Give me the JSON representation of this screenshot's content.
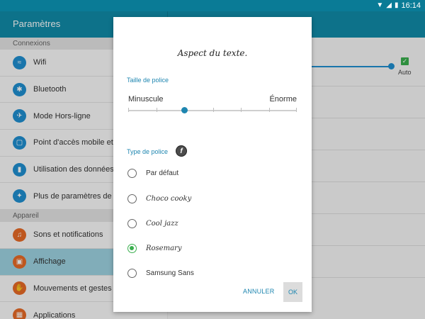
{
  "status_bar": {
    "time": "16:14"
  },
  "app_bar": {
    "title": "Paramètres"
  },
  "sidebar": {
    "sections": [
      {
        "header": "Connexions",
        "items": [
          {
            "label": "Wifi",
            "icon": "wifi-icon"
          },
          {
            "label": "Bluetooth",
            "icon": "bluetooth-icon"
          },
          {
            "label": "Mode Hors-ligne",
            "icon": "airplane-icon"
          },
          {
            "label": "Point d'accès mobile et",
            "icon": "hotspot-icon"
          },
          {
            "label": "Utilisation des données",
            "icon": "data-usage-icon"
          },
          {
            "label": "Plus de paramètres de c",
            "icon": "more-networks-icon"
          }
        ]
      },
      {
        "header": "Appareil",
        "items": [
          {
            "label": "Sons et notifications",
            "icon": "sound-icon"
          },
          {
            "label": "Affichage",
            "icon": "display-icon",
            "active": true
          },
          {
            "label": "Mouvements et gestes",
            "icon": "motion-icon"
          },
          {
            "label": "Applications",
            "icon": "apps-icon"
          }
        ]
      }
    ]
  },
  "right_pane": {
    "auto_label": "Auto"
  },
  "dialog": {
    "title": "Aspect du texte.",
    "font_size_label": "Taille de police",
    "size_min": "Minuscule",
    "size_max": "Énorme",
    "font_type_label": "Type de police",
    "font_badge": "f",
    "options": [
      {
        "label": "Par défaut",
        "checked": false
      },
      {
        "label": "Choco cooky",
        "checked": false
      },
      {
        "label": "Cool jazz",
        "checked": false
      },
      {
        "label": "Rosemary",
        "checked": true
      },
      {
        "label": "Samsung Sans",
        "checked": false
      }
    ],
    "cancel": "ANNULER",
    "ok": "OK"
  },
  "colors": {
    "accent": "#1e86b0",
    "appbar": "#108ca9",
    "statusbar": "#0a7b96",
    "radio_checked": "#3aaf4e"
  }
}
